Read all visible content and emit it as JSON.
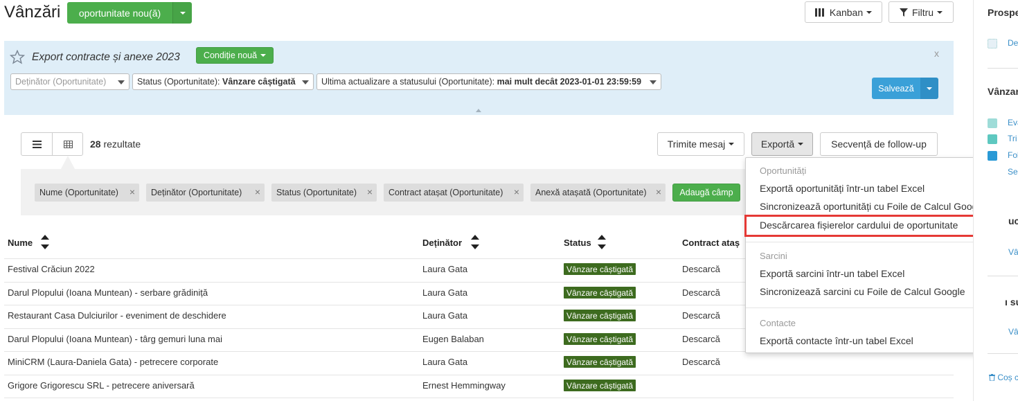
{
  "header": {
    "title": "Vânzări",
    "new_opportunity_label": "oportunitate nou(ă)",
    "kanban_label": "Kanban",
    "filter_label": "Filtru"
  },
  "filter_panel": {
    "saved_filter_name": "Export contracte și anexe 2023",
    "new_condition_label": "Condiție nouă",
    "close_label": "x",
    "owner_placeholder": "Deținător (Oportunitate)",
    "status_label": "Status (Oportunitate):",
    "status_value": "Vânzare câștigată",
    "last_update_label": "Ultima actualizare a statusului (Oportunitate):",
    "last_update_value": "mai mult decât 2023-01-01 23:59:59",
    "save_label": "Salvează"
  },
  "toolbar": {
    "results_count": "28",
    "results_label": "rezultate",
    "send_message_label": "Trimite mesaj",
    "export_label": "Exportă",
    "followup_label": "Secvență de follow-up"
  },
  "fields": [
    "Nume (Oportunitate)",
    "Deținător (Oportunitate)",
    "Status (Oportunitate)",
    "Contract atașat (Oportunitate)",
    "Anexă atașată (Oportunitate)"
  ],
  "add_field_label": "Adaugă câmp",
  "table": {
    "columns": [
      "Nume",
      "Deținător",
      "Status",
      "Contract ataș"
    ],
    "rows": [
      {
        "name": "Festival Crăciun 2022",
        "owner": "Laura Gata",
        "status": "Vânzare câștigată",
        "contract": "Descarcă"
      },
      {
        "name": "Darul Plopului (Ioana Muntean) - serbare grădiniță",
        "owner": "Laura Gata",
        "status": "Vânzare câștigată",
        "contract": "Descarcă"
      },
      {
        "name": "Restaurant Casa Dulciurilor - eveniment de deschidere",
        "owner": "Laura Gata",
        "status": "Vânzare câștigată",
        "contract": "Descarcă"
      },
      {
        "name": "Darul Plopului (Ioana Muntean) - târg gemuri luna mai",
        "owner": "Eugen Balaban",
        "status": "Vânzare câștigată",
        "contract": "Descarcă"
      },
      {
        "name": "MiniCRM (Laura-Daniela Gata) - petrecere corporate",
        "owner": "Laura Gata",
        "status": "Vânzare câștigată",
        "contract": "Descarcă"
      },
      {
        "name": "Grigore Grigorescu SRL - petrecere aniversară",
        "owner": "Ernest Hemmingway",
        "status": "Vânzare câștigată",
        "contract": ""
      }
    ]
  },
  "export_menu": {
    "section_opportunities": "Oportunități",
    "export_opps_excel": "Exportă oportunități într-un tabel Excel",
    "sync_opps_sheets": "Sincronizează oportunități cu Foile de Calcul Google",
    "download_card_files": "Descărcarea fișierelor cardului de oportunitate",
    "section_tasks": "Sarcini",
    "export_tasks_excel": "Exportă sarcini într-un tabel Excel",
    "sync_tasks_sheets": "Sincronizează sarcini cu Foile de Calcul Google",
    "section_contacts": "Contacte",
    "export_contacts_excel": "Exportă contacte într-un tabel Excel"
  },
  "sidebar": {
    "section1": "Prospe",
    "item_de": "De",
    "section2": "Vânzar",
    "item_eva": "Eva",
    "item_tri": "Tri",
    "item_fol": "Fol",
    "item_ser": "Ser",
    "section3": "uc",
    "item_van1": "Vân",
    "section4": "ı su",
    "item_van2": "Vân",
    "trash": "Coș c"
  },
  "colors": {
    "green": "#4cae4c",
    "blue": "#3aa0d8",
    "badge": "#3d6b1f",
    "highlight": "#e53935",
    "panel": "#dfeef8"
  }
}
